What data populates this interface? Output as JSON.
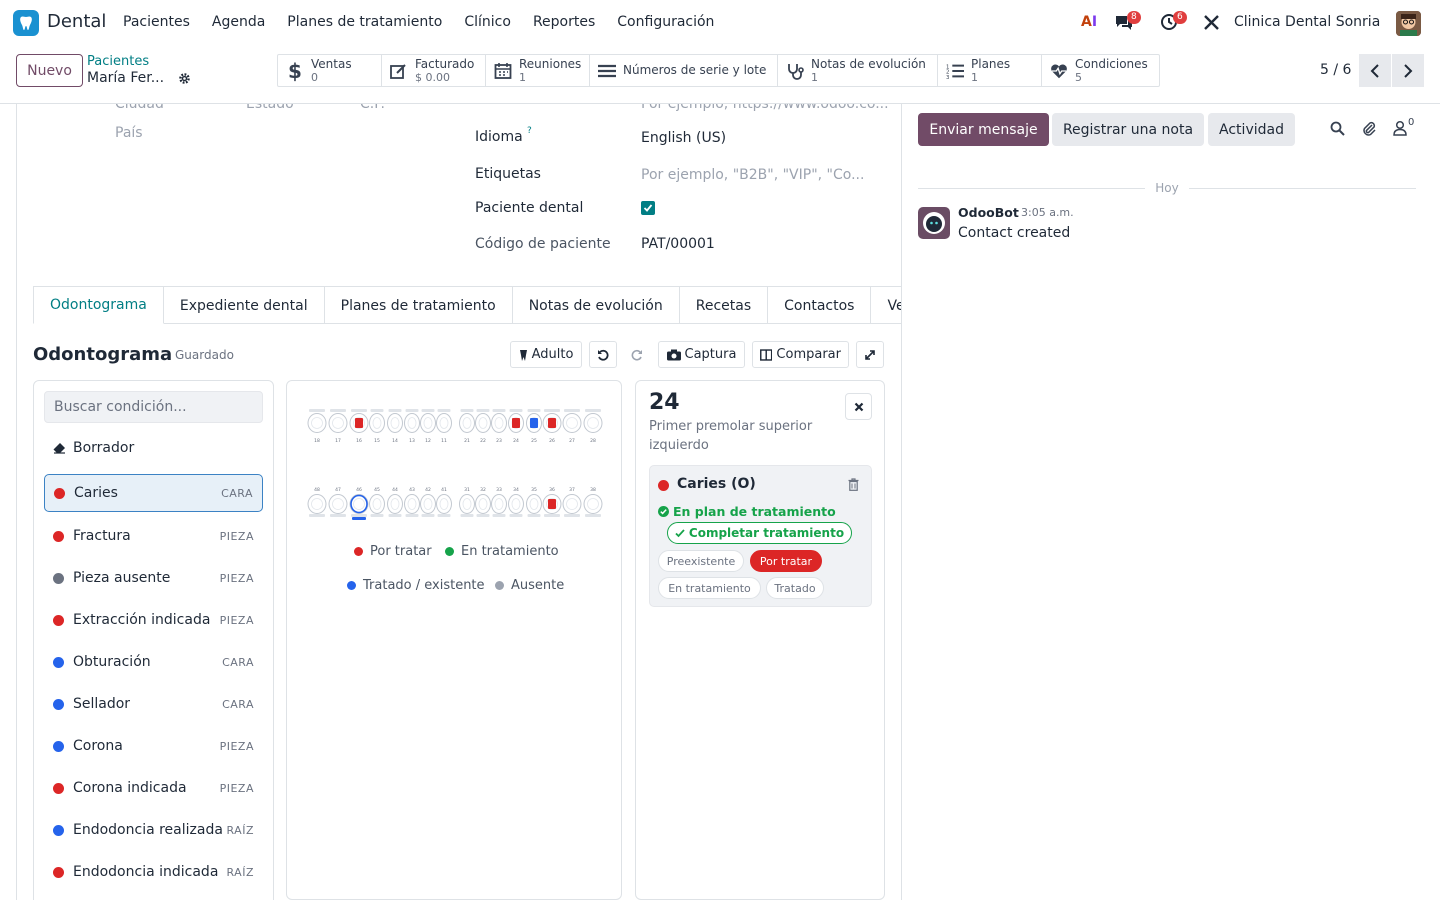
{
  "app": {
    "name": "Dental",
    "menu": [
      "Pacientes",
      "Agenda",
      "Planes de tratamiento",
      "Clínico",
      "Reportes",
      "Configuración"
    ],
    "company": "Clinica Dental Sonria",
    "messages_count": "8",
    "activities_count": "6"
  },
  "control": {
    "new_label": "Nuevo",
    "breadcrumb_parent": "Pacientes",
    "breadcrumb_current": "María Fer...",
    "stats": [
      {
        "label": "Ventas",
        "value": "0",
        "icon": "dollar-icon"
      },
      {
        "label": "Facturado",
        "value": "$ 0.00",
        "icon": "invoice-icon"
      },
      {
        "label": "Reuniones",
        "value": "1",
        "icon": "calendar-icon"
      },
      {
        "label": "Números de serie y lote",
        "value": "",
        "icon": "list-icon"
      },
      {
        "label": "Notas de evolución",
        "value": "1",
        "icon": "stethoscope-icon"
      },
      {
        "label": "Planes",
        "value": "1",
        "icon": "ordered-list-icon"
      },
      {
        "label": "Condiciones",
        "value": "5",
        "icon": "heartbeat-icon"
      }
    ],
    "pager": "5 / 6"
  },
  "form": {
    "cut_labels": [
      "Ciudad",
      "Estado",
      "C.P."
    ],
    "cut_placeholder": "Por ejemplo, https://www.odoo.co...",
    "country_placeholder": "País",
    "language_label": "Idioma",
    "language_help": "?",
    "language_value": "English (US)",
    "tags_label": "Etiquetas",
    "tags_placeholder": "Por ejemplo, \"B2B\", \"VIP\", \"Co...",
    "dental_patient_label": "Paciente dental",
    "patient_code_label": "Código de paciente",
    "patient_code_value": "PAT/00001"
  },
  "tabs": [
    "Odontograma",
    "Expediente dental",
    "Planes de tratamiento",
    "Notas de evolución",
    "Recetas",
    "Contactos",
    "Ve"
  ],
  "odontogram": {
    "title": "Odontograma",
    "status": "Guardado",
    "toolbar": {
      "adult": "Adulto",
      "capture": "Captura",
      "compare": "Comparar"
    },
    "search_placeholder": "Buscar condición...",
    "eraser": "Borrador",
    "conditions": [
      {
        "name": "Caries",
        "scope": "CARA",
        "color": "#dc2626"
      },
      {
        "name": "Fractura",
        "scope": "PIEZA",
        "color": "#dc2626"
      },
      {
        "name": "Pieza ausente",
        "scope": "PIEZA",
        "color": "#6b7280"
      },
      {
        "name": "Extracción indicada",
        "scope": "PIEZA",
        "color": "#dc2626"
      },
      {
        "name": "Obturación",
        "scope": "CARA",
        "color": "#2563eb"
      },
      {
        "name": "Sellador",
        "scope": "CARA",
        "color": "#2563eb"
      },
      {
        "name": "Corona",
        "scope": "PIEZA",
        "color": "#2563eb"
      },
      {
        "name": "Corona indicada",
        "scope": "PIEZA",
        "color": "#dc2626"
      },
      {
        "name": "Endodoncia realizada",
        "scope": "RAÍZ",
        "color": "#2563eb"
      },
      {
        "name": "Endodoncia indicada",
        "scope": "RAÍZ",
        "color": "#dc2626"
      }
    ],
    "upper_teeth": [
      "18",
      "17",
      "16",
      "15",
      "14",
      "13",
      "12",
      "11",
      "21",
      "22",
      "23",
      "24",
      "25",
      "26",
      "27",
      "28"
    ],
    "lower_teeth": [
      "48",
      "47",
      "46",
      "45",
      "44",
      "43",
      "42",
      "41",
      "31",
      "32",
      "33",
      "34",
      "35",
      "36",
      "37",
      "38"
    ],
    "legend": [
      {
        "label": "Por tratar",
        "color": "#dc2626"
      },
      {
        "label": "En tratamiento",
        "color": "#16a34a"
      },
      {
        "label": "Tratado / existente",
        "color": "#2563eb"
      },
      {
        "label": "Ausente",
        "color": "#9ca3af"
      }
    ],
    "detail": {
      "tooth": "24",
      "description": "Primer premolar superior izquierdo",
      "condition": "Caries (O)",
      "plan_status": "En plan de tratamiento",
      "complete_label": "Completar tratamiento",
      "states": [
        "Preexistente",
        "Por tratar",
        "En tratamiento",
        "Tratado"
      ],
      "active_state": "Por tratar"
    }
  },
  "chatter": {
    "send_message": "Enviar mensaje",
    "log_note": "Registrar una nota",
    "activity": "Actividad",
    "followers_count": "0",
    "date_separator": "Hoy",
    "messages": [
      {
        "author": "OdooBot",
        "time": "3:05 a.m.",
        "body": "Contact created"
      }
    ]
  },
  "colors": {
    "brand": "#714b67",
    "accent": "#017e84",
    "danger": "#dc2626",
    "success": "#16a34a",
    "info": "#2563eb"
  }
}
